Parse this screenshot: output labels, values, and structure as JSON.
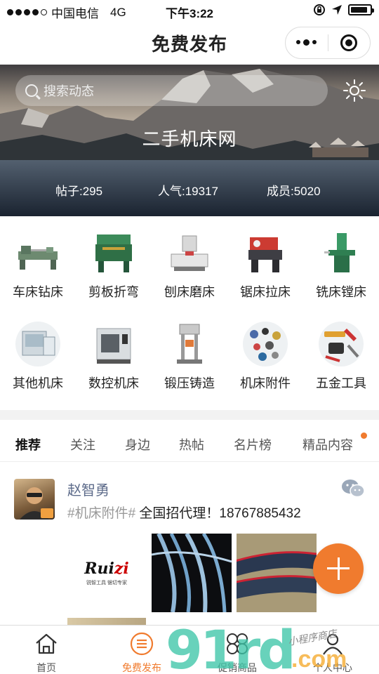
{
  "status_bar": {
    "carrier": "中国电信",
    "network": "4G",
    "time": "下午3:22",
    "battery_level": 0.9
  },
  "nav": {
    "title": "免费发布"
  },
  "banner": {
    "search_placeholder": "搜索动态",
    "site_name": "二手机床网",
    "stats": {
      "posts": "帖子:295",
      "popularity": "人气:19317",
      "members": "成员:5020"
    }
  },
  "categories": [
    {
      "label": "车床钻床",
      "icon": "lathe-icon"
    },
    {
      "label": "剪板折弯",
      "icon": "shearing-machine-icon"
    },
    {
      "label": "刨床磨床",
      "icon": "grinder-icon"
    },
    {
      "label": "锯床拉床",
      "icon": "band-saw-icon"
    },
    {
      "label": "铣床镗床",
      "icon": "milling-machine-icon"
    },
    {
      "label": "其他机床",
      "icon": "other-machine-icon"
    },
    {
      "label": "数控机床",
      "icon": "cnc-machine-icon"
    },
    {
      "label": "锻压铸造",
      "icon": "press-icon"
    },
    {
      "label": "机床附件",
      "icon": "accessories-icon"
    },
    {
      "label": "五金工具",
      "icon": "hardware-tools-icon"
    }
  ],
  "tabs": [
    "推荐",
    "关注",
    "身边",
    "热帖",
    "名片榜",
    "精品内容"
  ],
  "active_tab": "推荐",
  "post": {
    "author": "赵智勇",
    "tag": "#机床附件#",
    "text": "全国招代理！18767885432",
    "image_logo_main": "Rui",
    "image_logo_accent": "zi",
    "image_logo_sub": "锐智工具  锯切专家"
  },
  "tab_bar": [
    {
      "label": "首页",
      "icon": "home-icon"
    },
    {
      "label": "免费发布",
      "icon": "publish-icon"
    },
    {
      "label": "促销商品",
      "icon": "promo-icon"
    },
    {
      "label": "个人中心",
      "icon": "profile-icon"
    }
  ],
  "watermark": {
    "main": "91rd",
    "script": "小程序商店",
    "domain": ".com"
  },
  "colors": {
    "accent": "#f07b2e",
    "username": "#5d6b8a",
    "watermark": "#3ec6a8"
  }
}
